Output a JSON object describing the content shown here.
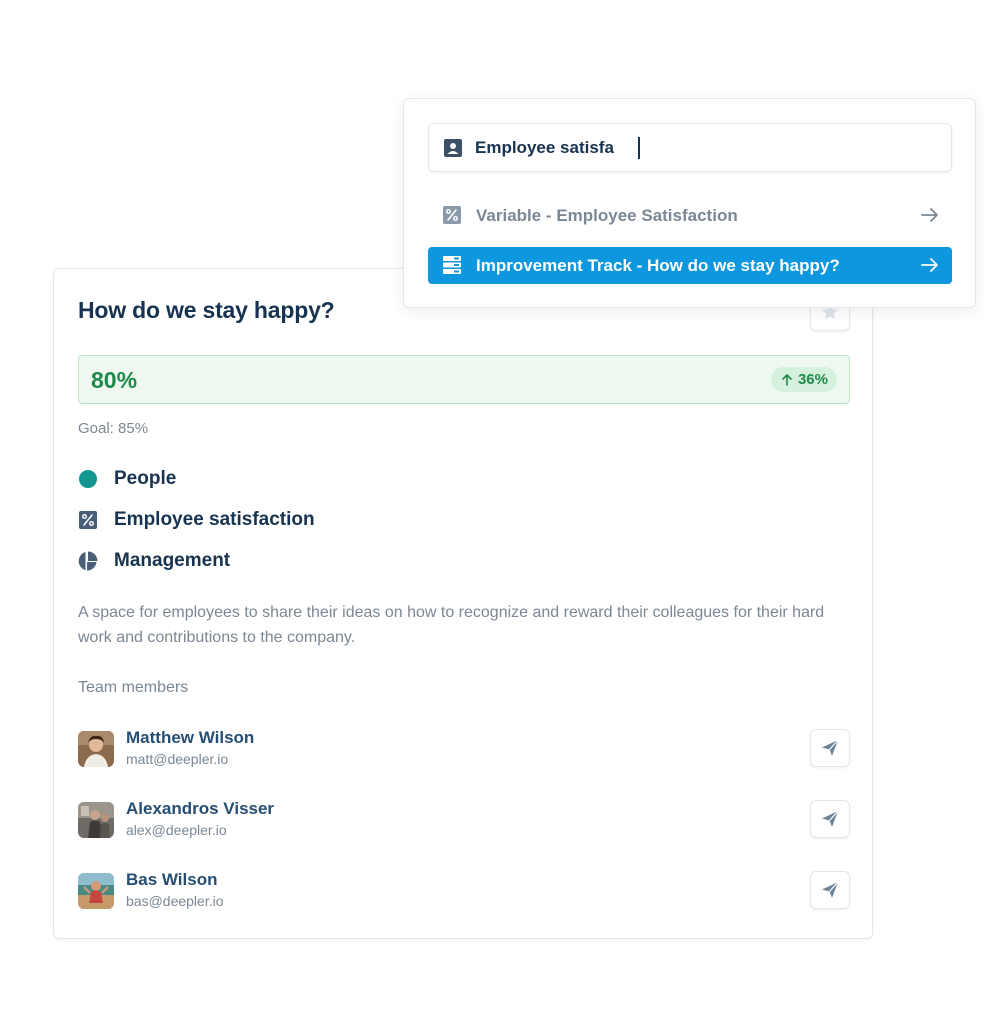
{
  "search": {
    "query": "Employee satisfa",
    "results": [
      {
        "label": "Variable - Employee Satisfaction",
        "icon": "percent-icon",
        "active": false
      },
      {
        "label": "Improvement Track - How do we stay happy?",
        "icon": "stack-icon",
        "active": true
      }
    ]
  },
  "track": {
    "title": "How do we stay happy?",
    "metric": {
      "value": "80%",
      "change": "36%",
      "direction": "up"
    },
    "goal": "Goal: 85%",
    "tags": [
      {
        "label": "People",
        "icon": "teal-dot-icon"
      },
      {
        "label": "Employee satisfaction",
        "icon": "percent-icon"
      },
      {
        "label": "Management",
        "icon": "pie-chart-icon"
      }
    ],
    "description": "A space for employees to share their ideas on how to recognize and reward their colleagues for their hard work and contributions to the company.",
    "team_label": "Team members",
    "members": [
      {
        "name": "Matthew Wilson",
        "email": "matt@deepler.io"
      },
      {
        "name": "Alexandros Visser",
        "email": "alex@deepler.io"
      },
      {
        "name": "Bas Wilson",
        "email": "bas@deepler.io"
      }
    ]
  },
  "colors": {
    "accent": "#0c97df",
    "positive": "#1e8a4a",
    "positive_bg": "#eef8f1",
    "heading": "#17334f",
    "muted": "#7b8794",
    "teal": "#13968f"
  }
}
